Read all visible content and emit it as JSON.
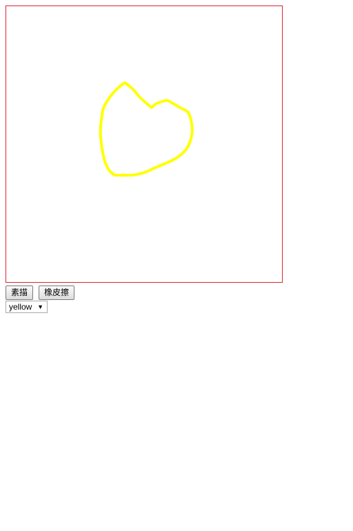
{
  "canvas": {
    "border_color": "#d9232e",
    "stroke_color": "#ffff00"
  },
  "toolbar": {
    "sketch_label": "素描",
    "eraser_label": "橡皮擦"
  },
  "color_select": {
    "selected": "yellow",
    "arrow_icon": "triangle-down-icon"
  }
}
